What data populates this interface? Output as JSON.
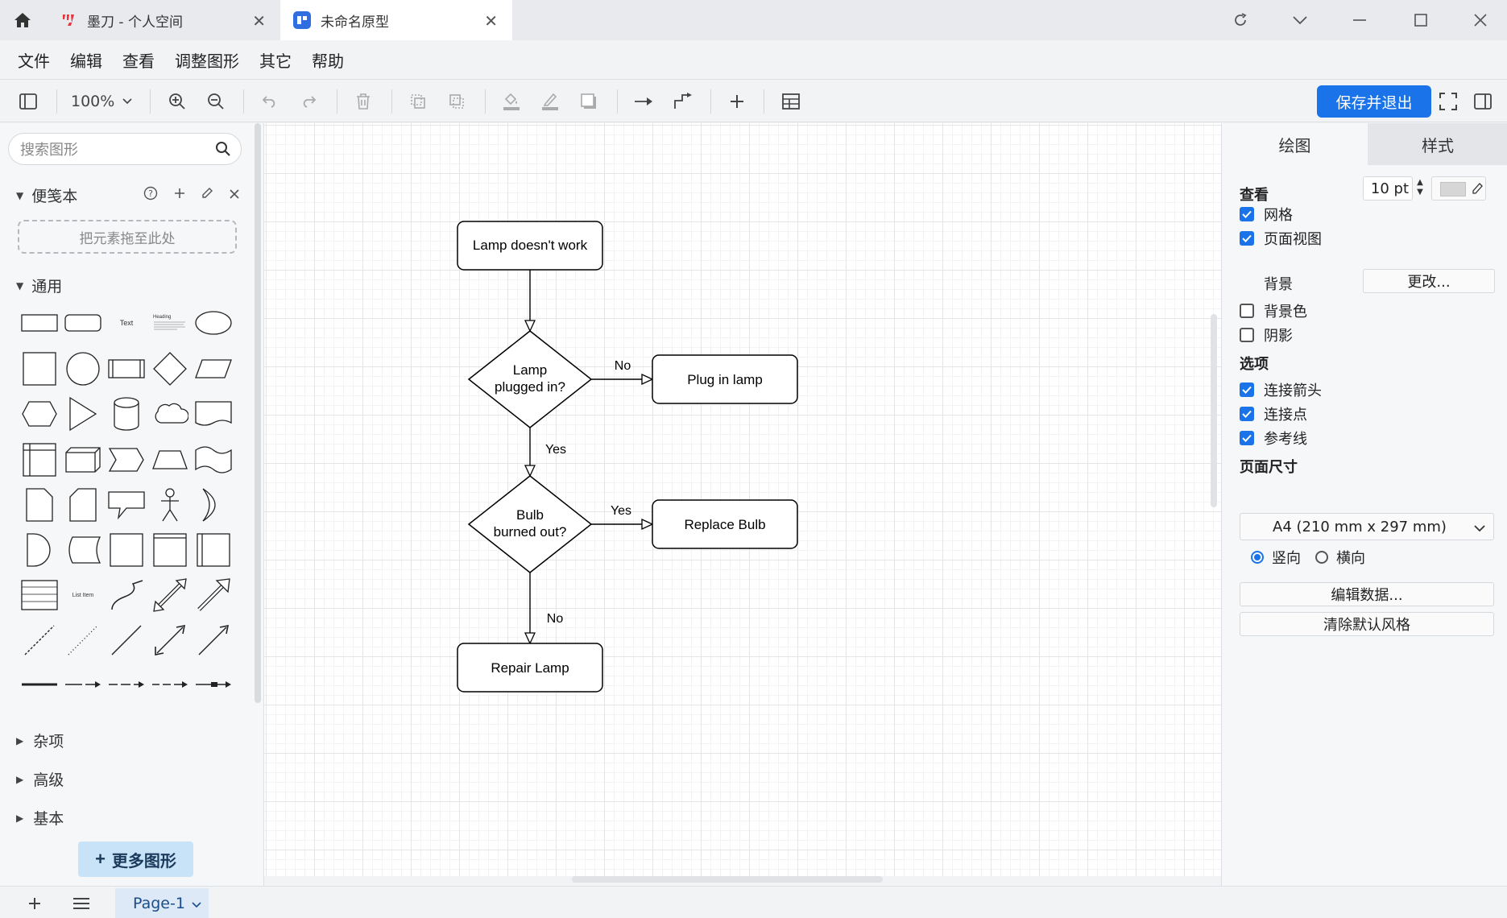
{
  "tabs": [
    {
      "title": "墨刀 - 个人空间"
    },
    {
      "title": "未命名原型"
    }
  ],
  "menu": [
    "文件",
    "编辑",
    "查看",
    "调整图形",
    "其它",
    "帮助"
  ],
  "toolbar": {
    "zoom": "100%",
    "save_label": "保存并退出"
  },
  "sidebar": {
    "search_placeholder": "搜索图形",
    "scratchpad": {
      "title": "便笺本",
      "drop_hint": "把元素拖至此处"
    },
    "general": {
      "title": "通用",
      "shape_text_label": "Text",
      "shape_heading_label": "Heading",
      "shape_listitem_label": "List Item"
    },
    "collapsed_sections": [
      "杂项",
      "高级",
      "基本"
    ],
    "more_shapes_label": "更多图形"
  },
  "diagram": {
    "nodes": {
      "start": "Lamp doesn't work",
      "q1_line1": "Lamp",
      "q1_line2": "plugged in?",
      "plug": "Plug in lamp",
      "q2_line1": "Bulb",
      "q2_line2": "burned out?",
      "replace": "Replace Bulb",
      "repair": "Repair Lamp"
    },
    "edges": {
      "q1_no": "No",
      "q1_yes": "Yes",
      "q2_yes": "Yes",
      "q2_no": "No"
    }
  },
  "right_panel": {
    "tabs": [
      "绘图",
      "样式"
    ],
    "view": {
      "heading": "查看",
      "grid": {
        "label": "网格",
        "checked": true,
        "size": "10 pt",
        "color": "#d6d6d6"
      },
      "page_view": {
        "label": "页面视图",
        "checked": true
      },
      "background": {
        "label": "背景",
        "button": "更改..."
      },
      "background_color": {
        "label": "背景色",
        "checked": false
      },
      "shadow": {
        "label": "阴影",
        "checked": false
      }
    },
    "options": {
      "heading": "选项",
      "connection_arrows": {
        "label": "连接箭头",
        "checked": true
      },
      "connection_points": {
        "label": "连接点",
        "checked": true
      },
      "guides": {
        "label": "参考线",
        "checked": true
      }
    },
    "page_size": {
      "heading": "页面尺寸",
      "value": "A4 (210 mm x 297 mm)",
      "portrait": "竖向",
      "landscape": "横向",
      "orientation": "portrait"
    },
    "edit_data_button": "编辑数据...",
    "clear_style_button": "清除默认风格"
  },
  "bottom": {
    "page_tab": "Page-1"
  },
  "colors": {
    "accent": "#1a73e8",
    "more_shapes_bg": "#c8e2f7"
  }
}
